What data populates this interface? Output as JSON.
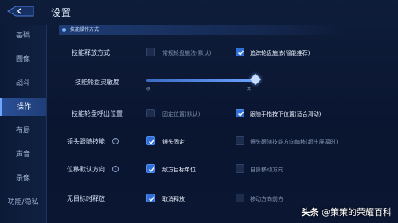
{
  "header": {
    "title": "设置"
  },
  "sidebar": {
    "items": [
      {
        "label": "基础"
      },
      {
        "label": "图像"
      },
      {
        "label": "战斗"
      },
      {
        "label": "操作"
      },
      {
        "label": "布局"
      },
      {
        "label": "声音"
      },
      {
        "label": "录像"
      },
      {
        "label": "功能/隐私"
      }
    ],
    "active_index": 3
  },
  "section": {
    "title": "技能操作方式"
  },
  "rows": [
    {
      "label": "技能释放方式",
      "options": [
        {
          "label": "常规轮盘施法(默认)",
          "checked": false
        },
        {
          "label": "追踪轮盘施法(智能推荐)",
          "checked": true
        }
      ]
    },
    {
      "label": "技能轮盘灵敏度",
      "slider": {
        "low_label": "低",
        "high_label": "高",
        "value": 0.95
      }
    },
    {
      "label": "技能轮盘呼出位置",
      "options": [
        {
          "label": "固定位置(默认)",
          "checked": false
        },
        {
          "label": "跟随手指按下位置(适合滑动)",
          "checked": true
        }
      ]
    },
    {
      "label": "镜头跟随技能",
      "options": [
        {
          "label": "镜头固定",
          "checked": true
        },
        {
          "label": "镜头跟随技能方向偏移(超出屏幕时)",
          "checked": false
        }
      ]
    },
    {
      "label": "位移默认方向",
      "options": [
        {
          "label": "敌方目标单位",
          "checked": true
        },
        {
          "label": "自身移动方向",
          "checked": false
        }
      ]
    },
    {
      "label": "无目标时释放",
      "options": [
        {
          "label": "取消释放",
          "checked": true
        },
        {
          "label": "移动方向前方",
          "checked": false
        }
      ]
    }
  ],
  "watermark": {
    "prefix": "头条",
    "text": "@策策的荣耀百科"
  },
  "colors": {
    "accent": "#2f6fd6",
    "background": "#0b1730"
  }
}
